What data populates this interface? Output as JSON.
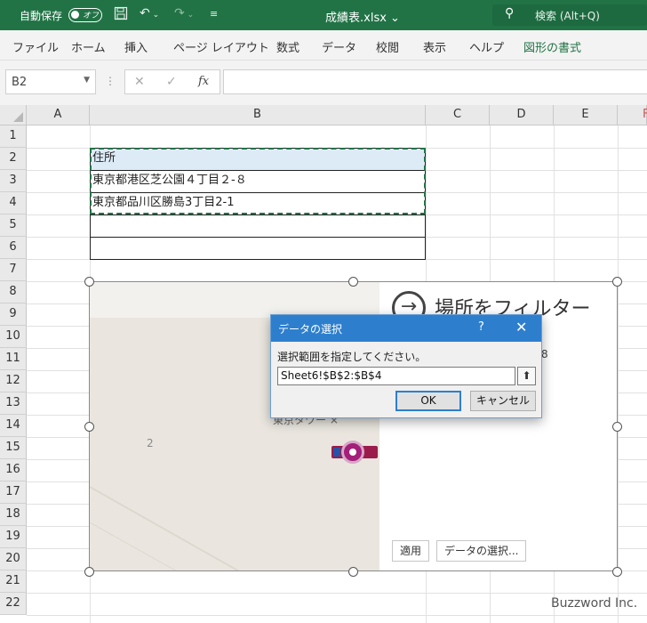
{
  "titlebar": {
    "autosave_label": "自動保存",
    "autosave_state": "オフ",
    "filename": "成績表.xlsx",
    "search_placeholder": "検索 (Alt+Q)"
  },
  "ribbon": {
    "tabs": [
      "ファイル",
      "ホーム",
      "挿入",
      "ページ レイアウト",
      "数式",
      "データ",
      "校閲",
      "表示",
      "ヘルプ",
      "図形の書式"
    ],
    "active_tab": "図形の書式"
  },
  "formula_bar": {
    "name_box": "B2",
    "fx_label": "fx",
    "value": ""
  },
  "grid": {
    "columns": [
      "A",
      "B",
      "C",
      "D",
      "E",
      "F"
    ],
    "rows": [
      "1",
      "2",
      "3",
      "4",
      "5",
      "6",
      "7",
      "8",
      "9",
      "10",
      "11",
      "12",
      "13",
      "14",
      "15",
      "16",
      "17",
      "18",
      "19",
      "20",
      "21",
      "22"
    ],
    "cells": {
      "B2": "住所",
      "B3": "東京都港区芝公園４丁目２-８",
      "B4": "東京都品川区勝島3丁目2-1"
    }
  },
  "chart": {
    "filter_title": "場所をフィルター",
    "map_label_number": "2",
    "map_label_tower": "東京タワー",
    "legend_fragment": "8",
    "apply_button": "適用",
    "select_data_button": "データの選択..."
  },
  "dialog": {
    "title": "データの選択",
    "help": "?",
    "close": "✕",
    "prompt": "選択範囲を指定してください。",
    "range_value": "Sheet6!$B$2:$B$4",
    "ok": "OK",
    "cancel": "キャンセル"
  },
  "watermark": "Buzzword Inc.",
  "colors": {
    "excel_green": "#217346",
    "dialog_blue": "#2d7fce",
    "map_pin": "#a31f7a"
  }
}
